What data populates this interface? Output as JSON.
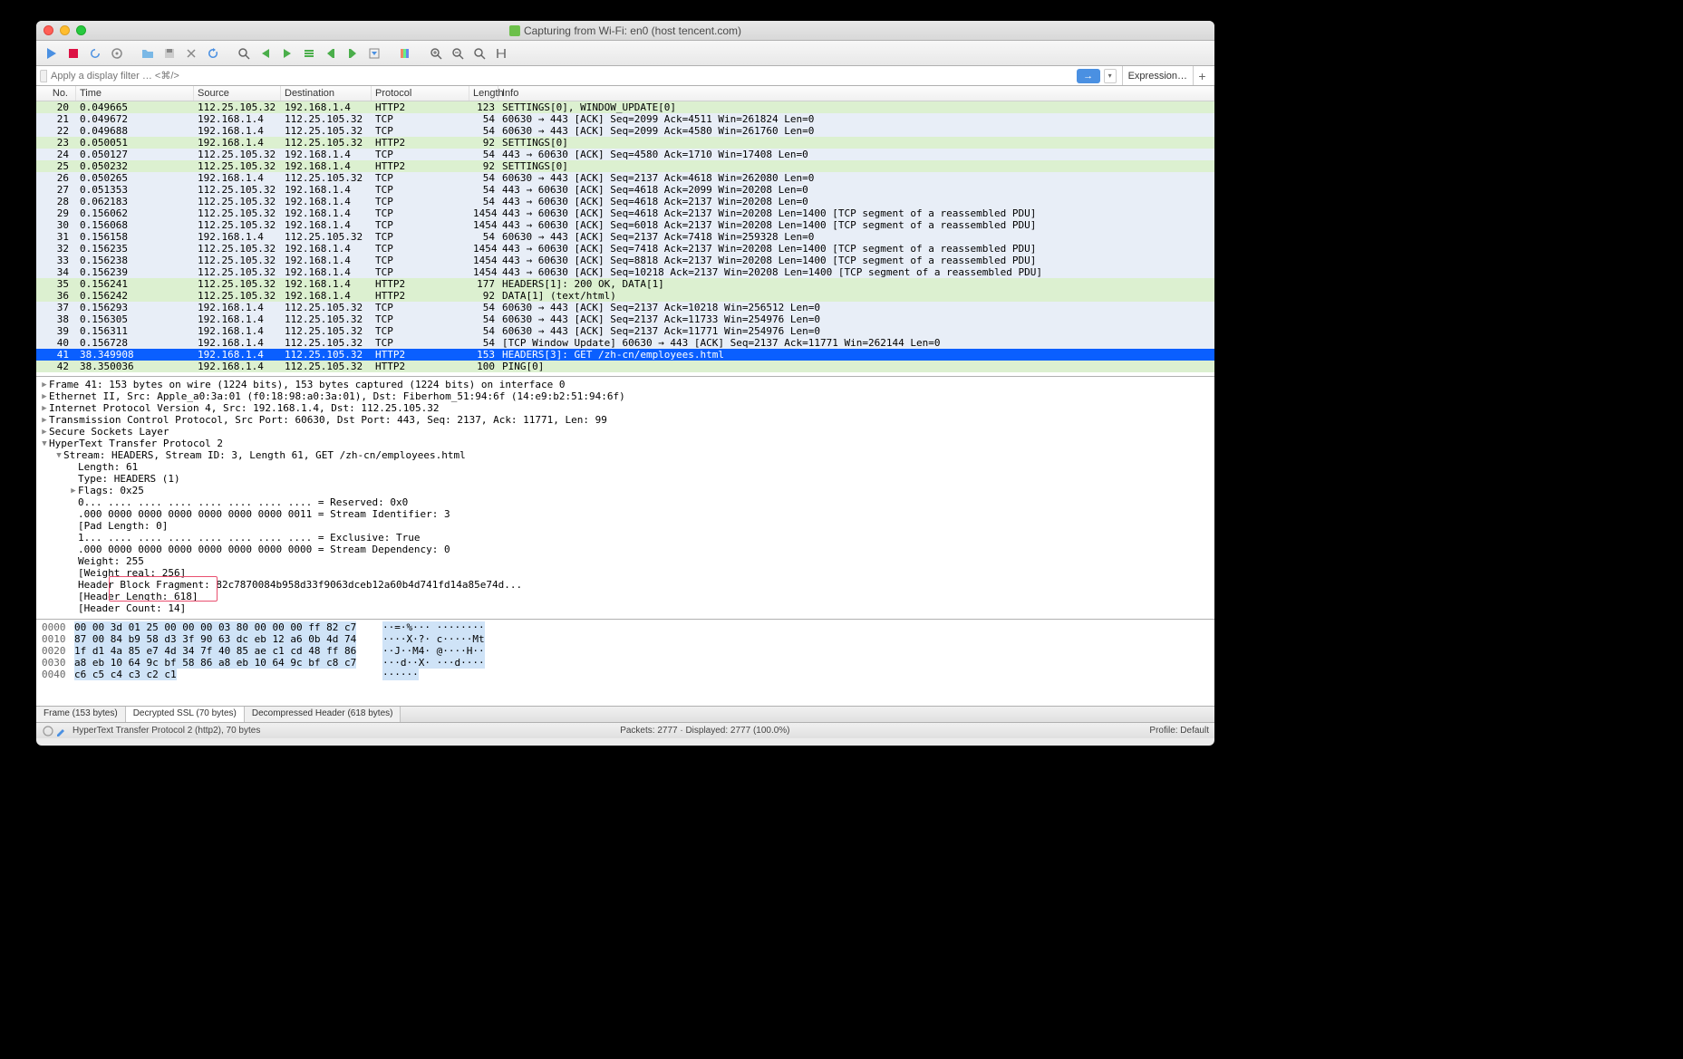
{
  "title": "Capturing from Wi-Fi: en0 (host tencent.com)",
  "filter_placeholder": "Apply a display filter … <⌘/>",
  "expression_label": "Expression…",
  "columns": [
    "No.",
    "Time",
    "Source",
    "Destination",
    "Protocol",
    "Length",
    "Info"
  ],
  "packets": [
    {
      "no": 20,
      "time": "0.049665",
      "src": "112.25.105.32",
      "dst": "192.168.1.4",
      "proto": "HTTP2",
      "len": 123,
      "info": "SETTINGS[0], WINDOW_UPDATE[0]",
      "cls": "http2"
    },
    {
      "no": 21,
      "time": "0.049672",
      "src": "192.168.1.4",
      "dst": "112.25.105.32",
      "proto": "TCP",
      "len": 54,
      "info": "60630 → 443 [ACK] Seq=2099 Ack=4511 Win=261824 Len=0",
      "cls": "tcp"
    },
    {
      "no": 22,
      "time": "0.049688",
      "src": "192.168.1.4",
      "dst": "112.25.105.32",
      "proto": "TCP",
      "len": 54,
      "info": "60630 → 443 [ACK] Seq=2099 Ack=4580 Win=261760 Len=0",
      "cls": "tcp"
    },
    {
      "no": 23,
      "time": "0.050051",
      "src": "192.168.1.4",
      "dst": "112.25.105.32",
      "proto": "HTTP2",
      "len": 92,
      "info": "SETTINGS[0]",
      "cls": "http2"
    },
    {
      "no": 24,
      "time": "0.050127",
      "src": "112.25.105.32",
      "dst": "192.168.1.4",
      "proto": "TCP",
      "len": 54,
      "info": "443 → 60630 [ACK] Seq=4580 Ack=1710 Win=17408 Len=0",
      "cls": "tcp"
    },
    {
      "no": 25,
      "time": "0.050232",
      "src": "112.25.105.32",
      "dst": "192.168.1.4",
      "proto": "HTTP2",
      "len": 92,
      "info": "SETTINGS[0]",
      "cls": "http2"
    },
    {
      "no": 26,
      "time": "0.050265",
      "src": "192.168.1.4",
      "dst": "112.25.105.32",
      "proto": "TCP",
      "len": 54,
      "info": "60630 → 443 [ACK] Seq=2137 Ack=4618 Win=262080 Len=0",
      "cls": "tcp"
    },
    {
      "no": 27,
      "time": "0.051353",
      "src": "112.25.105.32",
      "dst": "192.168.1.4",
      "proto": "TCP",
      "len": 54,
      "info": "443 → 60630 [ACK] Seq=4618 Ack=2099 Win=20208 Len=0",
      "cls": "tcp"
    },
    {
      "no": 28,
      "time": "0.062183",
      "src": "112.25.105.32",
      "dst": "192.168.1.4",
      "proto": "TCP",
      "len": 54,
      "info": "443 → 60630 [ACK] Seq=4618 Ack=2137 Win=20208 Len=0",
      "cls": "tcp"
    },
    {
      "no": 29,
      "time": "0.156062",
      "src": "112.25.105.32",
      "dst": "192.168.1.4",
      "proto": "TCP",
      "len": 1454,
      "info": "443 → 60630 [ACK] Seq=4618 Ack=2137 Win=20208 Len=1400 [TCP segment of a reassembled PDU]",
      "cls": "tcp"
    },
    {
      "no": 30,
      "time": "0.156068",
      "src": "112.25.105.32",
      "dst": "192.168.1.4",
      "proto": "TCP",
      "len": 1454,
      "info": "443 → 60630 [ACK] Seq=6018 Ack=2137 Win=20208 Len=1400 [TCP segment of a reassembled PDU]",
      "cls": "tcp"
    },
    {
      "no": 31,
      "time": "0.156158",
      "src": "192.168.1.4",
      "dst": "112.25.105.32",
      "proto": "TCP",
      "len": 54,
      "info": "60630 → 443 [ACK] Seq=2137 Ack=7418 Win=259328 Len=0",
      "cls": "tcp"
    },
    {
      "no": 32,
      "time": "0.156235",
      "src": "112.25.105.32",
      "dst": "192.168.1.4",
      "proto": "TCP",
      "len": 1454,
      "info": "443 → 60630 [ACK] Seq=7418 Ack=2137 Win=20208 Len=1400 [TCP segment of a reassembled PDU]",
      "cls": "tcp"
    },
    {
      "no": 33,
      "time": "0.156238",
      "src": "112.25.105.32",
      "dst": "192.168.1.4",
      "proto": "TCP",
      "len": 1454,
      "info": "443 → 60630 [ACK] Seq=8818 Ack=2137 Win=20208 Len=1400 [TCP segment of a reassembled PDU]",
      "cls": "tcp"
    },
    {
      "no": 34,
      "time": "0.156239",
      "src": "112.25.105.32",
      "dst": "192.168.1.4",
      "proto": "TCP",
      "len": 1454,
      "info": "443 → 60630 [ACK] Seq=10218 Ack=2137 Win=20208 Len=1400 [TCP segment of a reassembled PDU]",
      "cls": "tcp"
    },
    {
      "no": 35,
      "time": "0.156241",
      "src": "112.25.105.32",
      "dst": "192.168.1.4",
      "proto": "HTTP2",
      "len": 177,
      "info": "HEADERS[1]: 200 OK, DATA[1]",
      "cls": "http2"
    },
    {
      "no": 36,
      "time": "0.156242",
      "src": "112.25.105.32",
      "dst": "192.168.1.4",
      "proto": "HTTP2",
      "len": 92,
      "info": "DATA[1] (text/html)",
      "cls": "http2"
    },
    {
      "no": 37,
      "time": "0.156293",
      "src": "192.168.1.4",
      "dst": "112.25.105.32",
      "proto": "TCP",
      "len": 54,
      "info": "60630 → 443 [ACK] Seq=2137 Ack=10218 Win=256512 Len=0",
      "cls": "tcp"
    },
    {
      "no": 38,
      "time": "0.156305",
      "src": "192.168.1.4",
      "dst": "112.25.105.32",
      "proto": "TCP",
      "len": 54,
      "info": "60630 → 443 [ACK] Seq=2137 Ack=11733 Win=254976 Len=0",
      "cls": "tcp"
    },
    {
      "no": 39,
      "time": "0.156311",
      "src": "192.168.1.4",
      "dst": "112.25.105.32",
      "proto": "TCP",
      "len": 54,
      "info": "60630 → 443 [ACK] Seq=2137 Ack=11771 Win=254976 Len=0",
      "cls": "tcp"
    },
    {
      "no": 40,
      "time": "0.156728",
      "src": "192.168.1.4",
      "dst": "112.25.105.32",
      "proto": "TCP",
      "len": 54,
      "info": "[TCP Window Update] 60630 → 443 [ACK] Seq=2137 Ack=11771 Win=262144 Len=0",
      "cls": "tcp"
    },
    {
      "no": 41,
      "time": "38.349908",
      "src": "192.168.1.4",
      "dst": "112.25.105.32",
      "proto": "HTTP2",
      "len": 153,
      "info": "HEADERS[3]: GET /zh-cn/employees.html",
      "cls": "sel"
    },
    {
      "no": 42,
      "time": "38.350036",
      "src": "192.168.1.4",
      "dst": "112.25.105.32",
      "proto": "HTTP2",
      "len": 100,
      "info": "PING[0]",
      "cls": "http2"
    }
  ],
  "details": [
    {
      "ind": 0,
      "tri": "right",
      "txt": "Frame 41: 153 bytes on wire (1224 bits), 153 bytes captured (1224 bits) on interface 0"
    },
    {
      "ind": 0,
      "tri": "right",
      "txt": "Ethernet II, Src: Apple_a0:3a:01 (f0:18:98:a0:3a:01), Dst: Fiberhom_51:94:6f (14:e9:b2:51:94:6f)"
    },
    {
      "ind": 0,
      "tri": "right",
      "txt": "Internet Protocol Version 4, Src: 192.168.1.4, Dst: 112.25.105.32"
    },
    {
      "ind": 0,
      "tri": "right",
      "txt": "Transmission Control Protocol, Src Port: 60630, Dst Port: 443, Seq: 2137, Ack: 11771, Len: 99"
    },
    {
      "ind": 0,
      "tri": "right",
      "txt": "Secure Sockets Layer"
    },
    {
      "ind": 0,
      "tri": "down",
      "txt": "HyperText Transfer Protocol 2"
    },
    {
      "ind": 1,
      "tri": "down",
      "txt": "Stream: HEADERS, Stream ID: 3, Length 61, GET /zh-cn/employees.html"
    },
    {
      "ind": 2,
      "tri": "",
      "txt": "Length: 61"
    },
    {
      "ind": 2,
      "tri": "",
      "txt": "Type: HEADERS (1)"
    },
    {
      "ind": 2,
      "tri": "right",
      "txt": "Flags: 0x25"
    },
    {
      "ind": 2,
      "tri": "",
      "txt": "0... .... .... .... .... .... .... .... = Reserved: 0x0"
    },
    {
      "ind": 2,
      "tri": "",
      "txt": ".000 0000 0000 0000 0000 0000 0000 0011 = Stream Identifier: 3"
    },
    {
      "ind": 2,
      "tri": "",
      "txt": "[Pad Length: 0]"
    },
    {
      "ind": 2,
      "tri": "",
      "txt": "1... .... .... .... .... .... .... .... = Exclusive: True"
    },
    {
      "ind": 2,
      "tri": "",
      "txt": ".000 0000 0000 0000 0000 0000 0000 0000 = Stream Dependency: 0"
    },
    {
      "ind": 2,
      "tri": "",
      "txt": "Weight: 255"
    },
    {
      "ind": 2,
      "tri": "",
      "txt": "[Weight real: 256]"
    },
    {
      "ind": 2,
      "tri": "",
      "txt": "Header Block Fragment: 82c7870084b958d33f9063dceb12a60b4d741fd14a85e74d..."
    },
    {
      "ind": 2,
      "tri": "",
      "txt": "[Header Length: 618]"
    },
    {
      "ind": 2,
      "tri": "",
      "txt": "[Header Count: 14]"
    }
  ],
  "hex": [
    {
      "off": "0000",
      "hex": "00 00 3d 01 25 00 00 00  03 80 00 00 00 ff 82 c7",
      "asc": "··=·%··· ········",
      "hlh": [
        0,
        48
      ],
      "hla": [
        0,
        17
      ]
    },
    {
      "off": "0010",
      "hex": "87 00 84 b9 58 d3 3f 90  63 dc eb 12 a6 0b 4d 74",
      "asc": "····X·?· c·····Mt",
      "hlh": [
        0,
        48
      ],
      "hla": [
        0,
        17
      ]
    },
    {
      "off": "0020",
      "hex": "1f d1 4a 85 e7 4d 34 7f  40 85 ae c1 cd 48 ff 86",
      "asc": "··J··M4· @····H··",
      "hlh": [
        0,
        48
      ],
      "hla": [
        0,
        17
      ]
    },
    {
      "off": "0030",
      "hex": "a8 eb 10 64 9c bf 58 86  a8 eb 10 64 9c bf c8 c7",
      "asc": "···d··X· ···d····",
      "hlh": [
        0,
        48
      ],
      "hla": [
        0,
        17
      ]
    },
    {
      "off": "0040",
      "hex": "c6 c5 c4 c3 c2 c1",
      "asc": "······",
      "hlh": [
        0,
        17
      ],
      "hla": [
        0,
        6
      ]
    }
  ],
  "tabs": [
    {
      "label": "Frame (153 bytes)",
      "active": false
    },
    {
      "label": "Decrypted SSL (70 bytes)",
      "active": true
    },
    {
      "label": "Decompressed Header (618 bytes)",
      "active": false
    }
  ],
  "status_left": "HyperText Transfer Protocol 2 (http2), 70 bytes",
  "status_mid": "Packets: 2777 · Displayed: 2777 (100.0%)",
  "status_right": "Profile: Default"
}
